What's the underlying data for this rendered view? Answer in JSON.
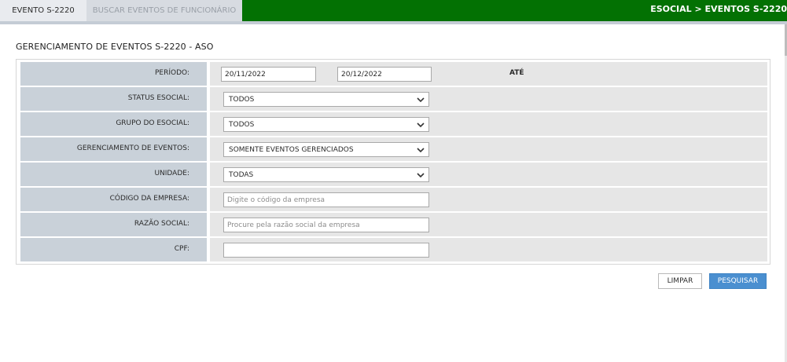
{
  "tabs": {
    "active": "EVENTO S-2220",
    "inactive": "BUSCAR EVENTOS DE FUNCIONÁRIO"
  },
  "breadcrumb": "ESOCIAL > EVENTOS S-2220",
  "page_title": "GERENCIAMENTO DE EVENTOS S-2220 - ASO",
  "form": {
    "periodo": {
      "label": "PERÍODO:",
      "start": "20/11/2022",
      "separator": "ATÉ",
      "end": "20/12/2022"
    },
    "status_esocial": {
      "label": "STATUS ESOCIAL:",
      "value": "TODOS"
    },
    "grupo_esocial": {
      "label": "GRUPO DO ESOCIAL:",
      "value": "TODOS"
    },
    "gerenciamento": {
      "label": "GERENCIAMENTO DE EVENTOS:",
      "value": "SOMENTE EVENTOS GERENCIADOS"
    },
    "unidade": {
      "label": "UNIDADE:",
      "value": "TODAS"
    },
    "codigo_empresa": {
      "label": "CÓDIGO DA EMPRESA:",
      "value": "",
      "placeholder": "Digite o código da empresa"
    },
    "razao_social": {
      "label": "RAZÃO SOCIAL:",
      "value": "",
      "placeholder": "Procure pela razão social da empresa"
    },
    "cpf": {
      "label": "CPF:",
      "value": "",
      "placeholder": ""
    }
  },
  "buttons": {
    "clear": "LIMPAR",
    "search": "PESQUISAR"
  },
  "colors": {
    "topbar": "#037103",
    "label_bg": "#c9d1d9",
    "value_bg": "#e6e6e6",
    "primary_button": "#4a8fd0"
  }
}
